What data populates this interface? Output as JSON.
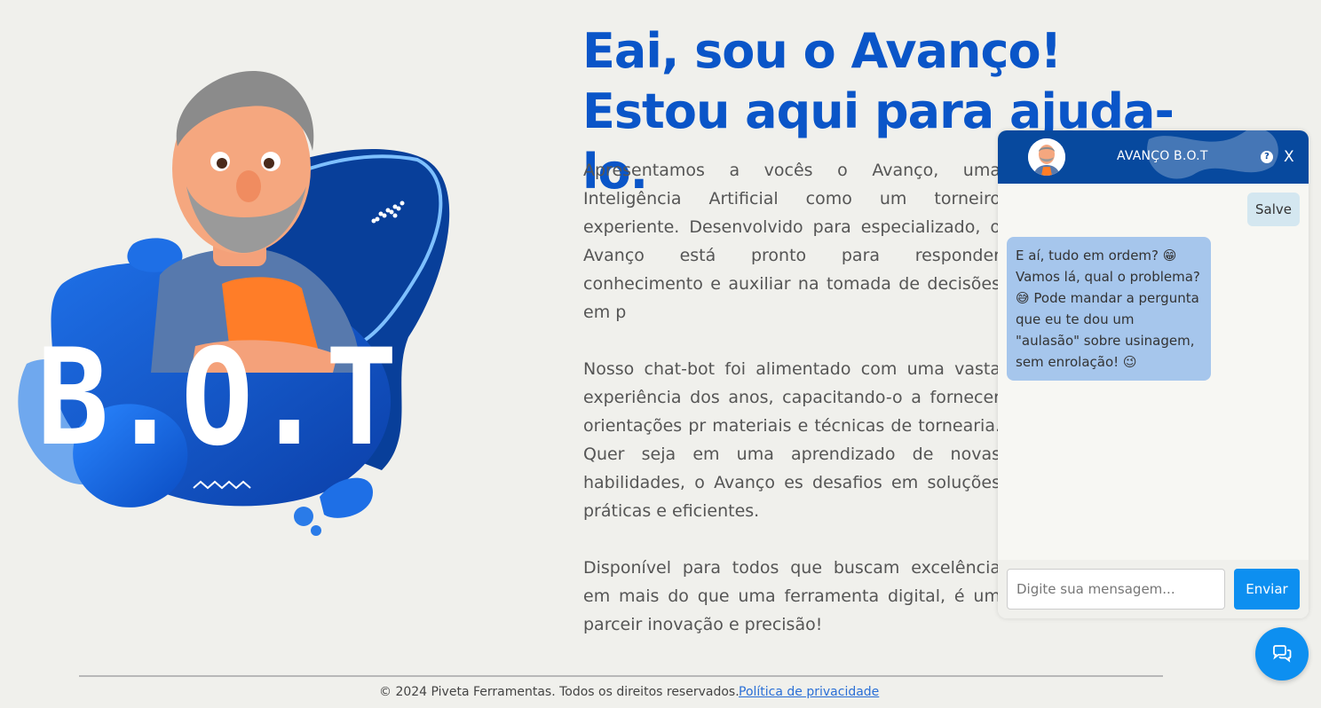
{
  "hero": {
    "badge_text": "B.O.T"
  },
  "headline": {
    "line1": "Eai, sou o Avanço!",
    "line2": "Estou aqui para ajuda-lo."
  },
  "intro": {
    "paragraphs": [
      "Apresentamos a vocês o Avanço, uma Inteligência Artificial como um torneiro experiente. Desenvolvido para especializado, o Avanço está pronto para responder conhecimento e auxiliar na tomada de decisões em p",
      "Nosso chat-bot foi alimentado com uma vasta experiência dos anos, capacitando-o a fornecer orientações pr materiais e técnicas de tornearia. Quer seja em uma aprendizado de novas habilidades, o Avanço es desafios em soluções práticas e eficientes.",
      "Disponível para todos que buscam excelência em mais do que uma ferramenta digital, é um parceir inovação e precisão!"
    ]
  },
  "chat": {
    "title": "AVANÇO B.O.T",
    "help_icon": "?",
    "close_label": "X",
    "user_message": "Salve",
    "bot_message": "E aí, tudo em ordem? 😁 Vamos lá, qual o problema? 😅 Pode mandar a pergunta que eu te dou um \"aulasão\" sobre usinagem, sem enrolação! 😉",
    "input_placeholder": "Digite sua mensagem...",
    "send_label": "Enviar"
  },
  "footer": {
    "copyright": "© 2024 Piveta Ferramentas. Todos os direitos reservados.",
    "privacy_link": "Política de privacidade"
  },
  "colors": {
    "brand_blue": "#0a55c8",
    "header_blue": "#07499e",
    "button_blue": "#0d8ff0"
  }
}
